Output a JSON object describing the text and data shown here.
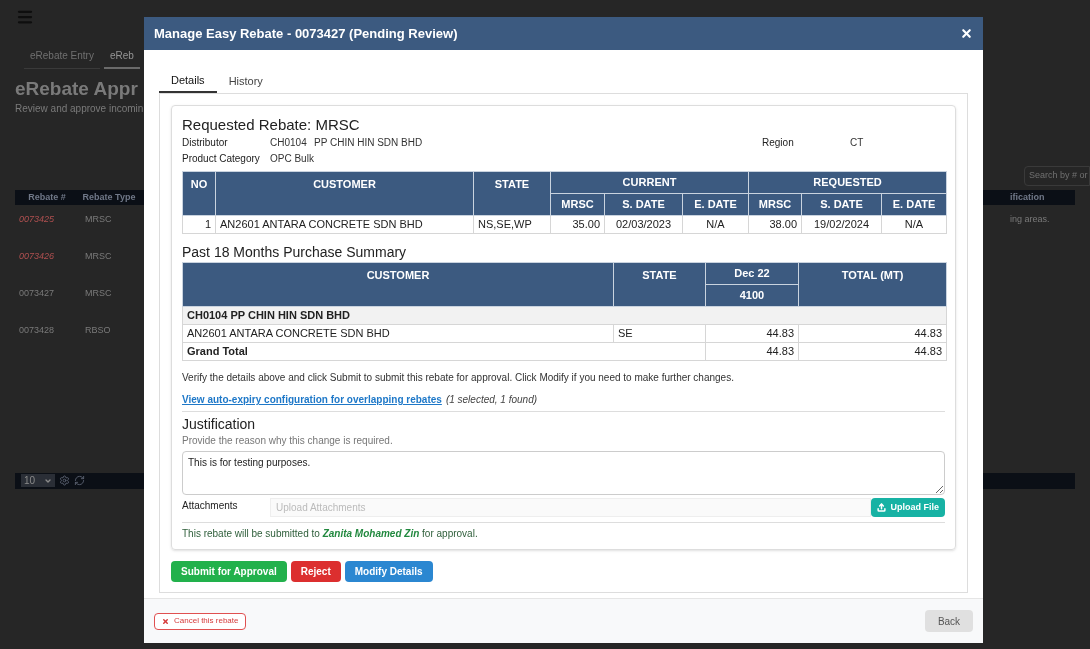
{
  "page": {
    "tabs": [
      {
        "label": "eRebate Entry",
        "selected": false
      },
      {
        "label": "eReb",
        "selected": true
      }
    ],
    "title": "eRebate Appr",
    "subtitle": "Review and approve incomin",
    "search": {
      "placeholder": "Search by # or"
    },
    "table": {
      "columns": [
        "Rebate #",
        "Rebate Type"
      ],
      "column_last": "ification",
      "rows": [
        {
          "rebate": "0073425",
          "type": "MRSC",
          "flagged": true,
          "note": "ing areas."
        },
        {
          "rebate": "0073426",
          "type": "MRSC",
          "flagged": true
        },
        {
          "rebate": "0073427",
          "type": "MRSC",
          "flagged": false
        },
        {
          "rebate": "0073428",
          "type": "RBSO",
          "flagged": false
        }
      ]
    },
    "pager": {
      "page_size": "10"
    }
  },
  "modal": {
    "title": "Manage Easy Rebate - 0073427 (Pending Review)",
    "tabs": [
      {
        "label": "Details",
        "selected": true
      },
      {
        "label": "History",
        "selected": false
      }
    ],
    "requested": {
      "heading": "Requested Rebate: MRSC",
      "distributor": {
        "label": "Distributor",
        "code": "CH0104",
        "name": "PP CHIN HIN SDN BHD"
      },
      "region": {
        "label": "Region",
        "value": "CT"
      },
      "product_category": {
        "label": "Product Category",
        "value": "OPC Bulk"
      },
      "columns": {
        "no": "NO",
        "customer": "CUSTOMER",
        "state": "STATE",
        "current": "CURRENT",
        "requested": "REQUESTED",
        "sub_columns": [
          "MRSC",
          "S. DATE",
          "E. DATE",
          "MRSC",
          "S. DATE",
          "E. DATE"
        ]
      },
      "rows": [
        {
          "cells": [
            "1",
            "AN2601 ANTARA CONCRETE SDN BHD",
            "NS,SE,WP",
            "35.00",
            "02/03/2023",
            "N/A",
            "38.00",
            "19/02/2024",
            "N/A"
          ]
        }
      ]
    },
    "summary": {
      "heading": "Past 18 Months Purchase Summary",
      "columns": {
        "customer": "CUSTOMER",
        "state": "STATE",
        "month": "Dec 22",
        "month_sub": "4100",
        "total": "TOTAL (MT)"
      },
      "group": "CH0104 PP CHIN HIN SDN BHD",
      "rows": [
        {
          "customer": "AN2601 ANTARA CONCRETE SDN BHD",
          "state": "SE",
          "month": "44.83",
          "total": "44.83"
        }
      ],
      "grand_total": {
        "label": "Grand Total",
        "month": "44.83",
        "total": "44.83"
      }
    },
    "instructions": "Verify the details above and click Submit to submit this rebate for approval. Click Modify if you need to make further changes.",
    "expiry_link": "View auto-expiry configuration for overlapping rebates",
    "expiry_note": "(1 selected, 1 found)",
    "justification": {
      "heading": "Justification",
      "hint": "Provide the reason why this change is required.",
      "value": "This is for testing purposes."
    },
    "attachments": {
      "label": "Attachments",
      "placeholder": "Upload Attachments",
      "button": "Upload File"
    },
    "approver": {
      "prefix": "This rebate will be submitted to",
      "name": "Zanita Mohamed Zin",
      "suffix": "for approval."
    },
    "actions": [
      {
        "label": "Submit for Approval",
        "kind": "success"
      },
      {
        "label": "Reject",
        "kind": "danger"
      },
      {
        "label": "Modify Details",
        "kind": "primary"
      }
    ],
    "footer": {
      "cancel": "Cancel this rebate",
      "back": "Back"
    }
  }
}
